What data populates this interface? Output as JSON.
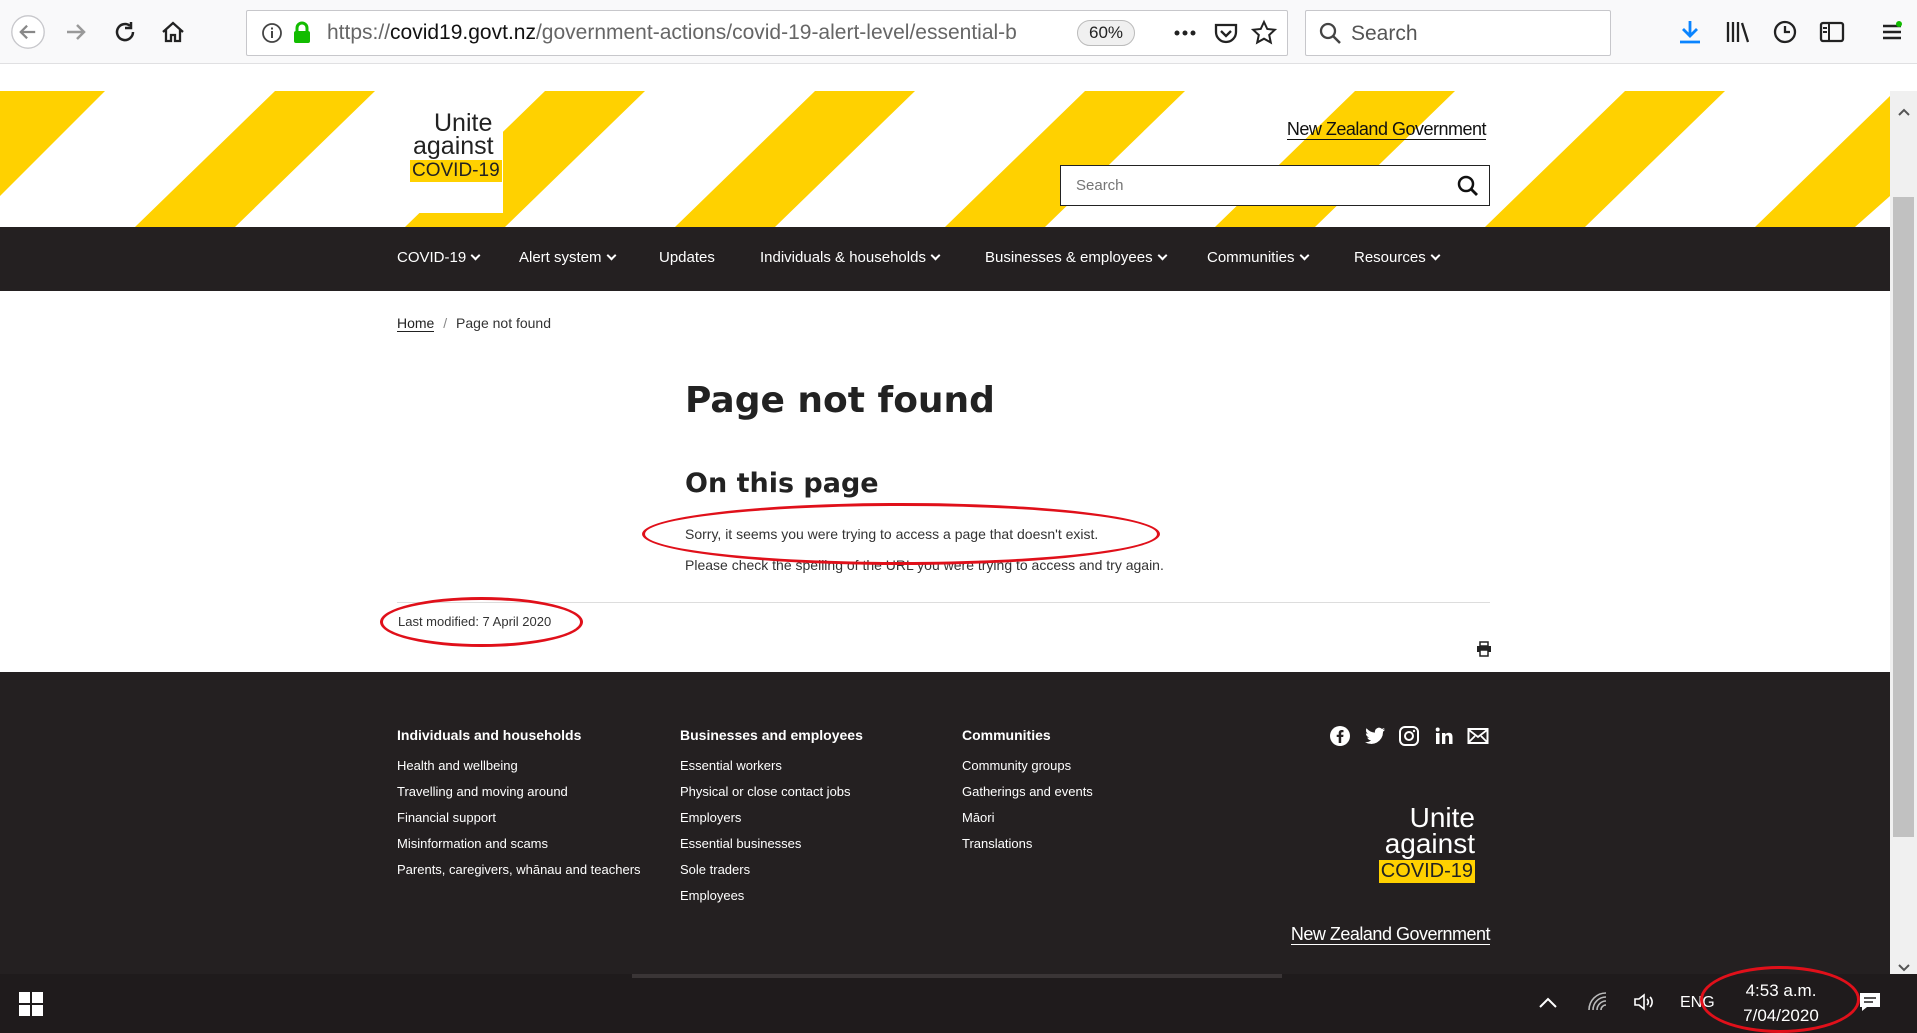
{
  "browser": {
    "url_scheme": "https://",
    "url_host": "covid19.govt.nz",
    "url_path": "/government-actions/covid-19-alert-level/essential-b",
    "zoom": "60%",
    "search_placeholder": "Search"
  },
  "header": {
    "logo": {
      "line1": "Unite",
      "line2": "against",
      "line3": "COVID-19"
    },
    "govt_brand": "New Zealand Government",
    "search_placeholder": "Search"
  },
  "nav": {
    "items": [
      {
        "label": "COVID-19",
        "dropdown": true
      },
      {
        "label": "Alert system",
        "dropdown": true
      },
      {
        "label": "Updates",
        "dropdown": false
      },
      {
        "label": "Individuals & households",
        "dropdown": true
      },
      {
        "label": "Businesses & employees",
        "dropdown": true
      },
      {
        "label": "Communities",
        "dropdown": true
      },
      {
        "label": "Resources",
        "dropdown": true
      }
    ]
  },
  "breadcrumb": {
    "home": "Home",
    "separator": "/",
    "current": "Page not found"
  },
  "content": {
    "title": "Page not found",
    "section_title": "On this page",
    "para1": "Sorry, it seems you were trying to access a page that doesn't exist.",
    "para2": "Please check the spelling of the URL you were trying to access and try again.",
    "last_modified": "Last modified: 7 April 2020"
  },
  "footer": {
    "columns": [
      {
        "heading": "Individuals and households",
        "links": [
          "Health and wellbeing",
          "Travelling and moving around",
          "Financial support",
          "Misinformation and scams",
          "Parents, caregivers, whānau and teachers"
        ]
      },
      {
        "heading": "Businesses and employees",
        "links": [
          "Essential workers",
          "Physical or close contact jobs",
          "Employers",
          "Essential businesses",
          "Sole traders",
          "Employees"
        ]
      },
      {
        "heading": "Communities",
        "links": [
          "Community groups",
          "Gatherings and events",
          "Māori",
          "Translations"
        ]
      }
    ],
    "social": [
      "facebook-icon",
      "twitter-icon",
      "instagram-icon",
      "linkedin-icon",
      "email-icon"
    ],
    "logo": {
      "line1": "Unite",
      "line2": "against",
      "line3": "COVID-19"
    },
    "govt_brand": "New Zealand Government"
  },
  "taskbar": {
    "language": "ENG",
    "time": "4:53 a.m.",
    "date": "7/04/2020"
  },
  "colors": {
    "brand_yellow": "#ffd100",
    "dark": "#242021",
    "annotation_red": "#e0101a"
  }
}
